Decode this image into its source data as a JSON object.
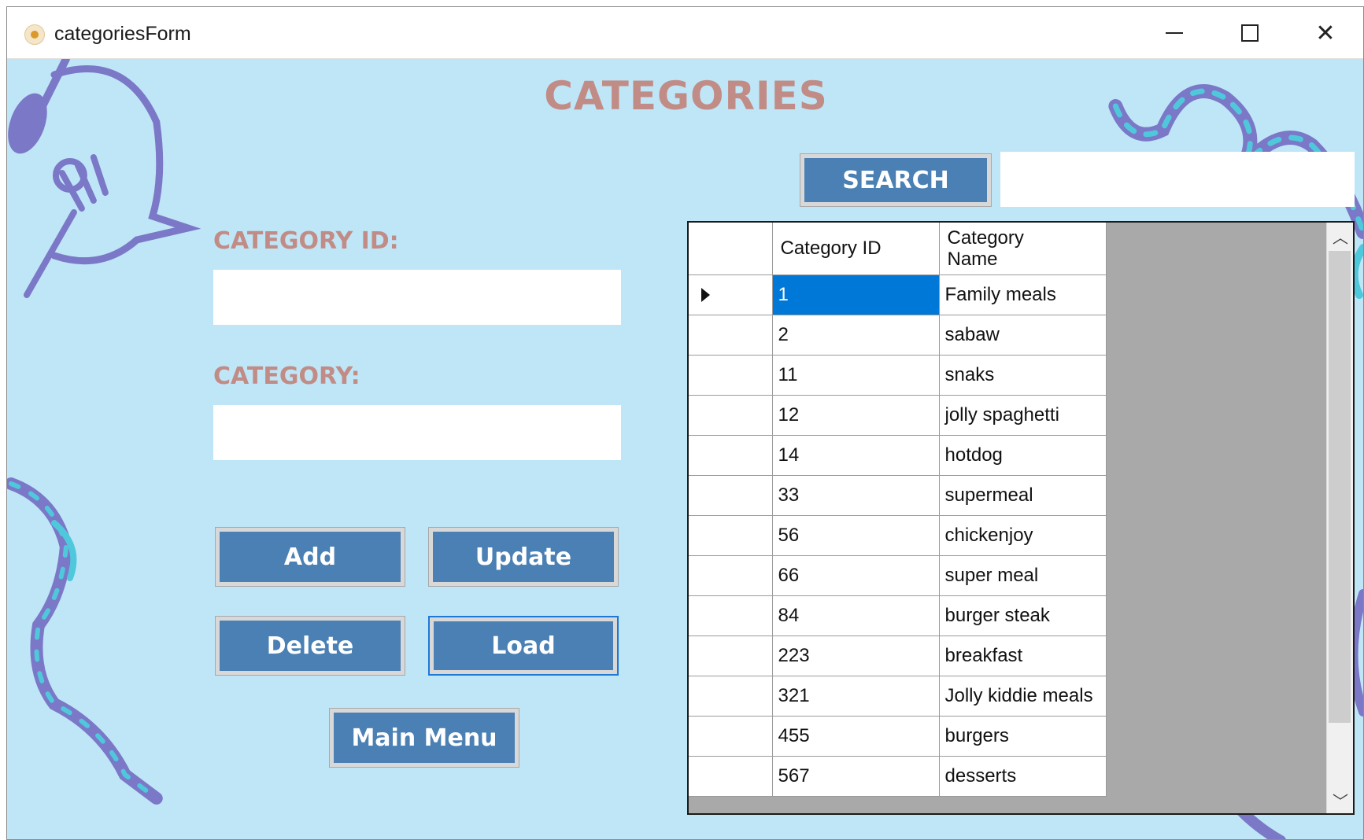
{
  "window": {
    "title": "categoriesForm",
    "icon": "app-icon",
    "controls": {
      "minimize": "minimize-icon",
      "maximize": "maximize-icon",
      "close": "✕"
    }
  },
  "form": {
    "heading": "CATEGORIES",
    "category_id_label": "CATEGORY ID:",
    "category_id_value": "",
    "category_label": "CATEGORY:",
    "category_value": "",
    "search_value": ""
  },
  "buttons": {
    "search": "SEARCH",
    "add": "Add",
    "update": "Update",
    "delete": "Delete",
    "load": "Load",
    "main_menu": "Main Menu"
  },
  "grid": {
    "columns": [
      "Category ID",
      "Category\nName"
    ],
    "selected_row": 0,
    "rows": [
      {
        "id": "1",
        "name": "Family meals"
      },
      {
        "id": "2",
        "name": "sabaw"
      },
      {
        "id": "11",
        "name": "snaks"
      },
      {
        "id": "12",
        "name": "jolly spaghetti"
      },
      {
        "id": "14",
        "name": "hotdog"
      },
      {
        "id": "33",
        "name": "supermeal"
      },
      {
        "id": "56",
        "name": "chickenjoy"
      },
      {
        "id": "66",
        "name": "super meal"
      },
      {
        "id": "84",
        "name": "burger steak"
      },
      {
        "id": "223",
        "name": "breakfast"
      },
      {
        "id": "321",
        "name": "Jolly kiddie meals"
      },
      {
        "id": "455",
        "name": "burgers"
      },
      {
        "id": "567",
        "name": "desserts"
      }
    ]
  },
  "colors": {
    "background": "#bfe6f7",
    "accent_text": "#c18c86",
    "button": "#4a80b4",
    "selection": "#0078d7",
    "decoration_purple": "#7b78c8",
    "decoration_teal": "#4fc8dc"
  }
}
